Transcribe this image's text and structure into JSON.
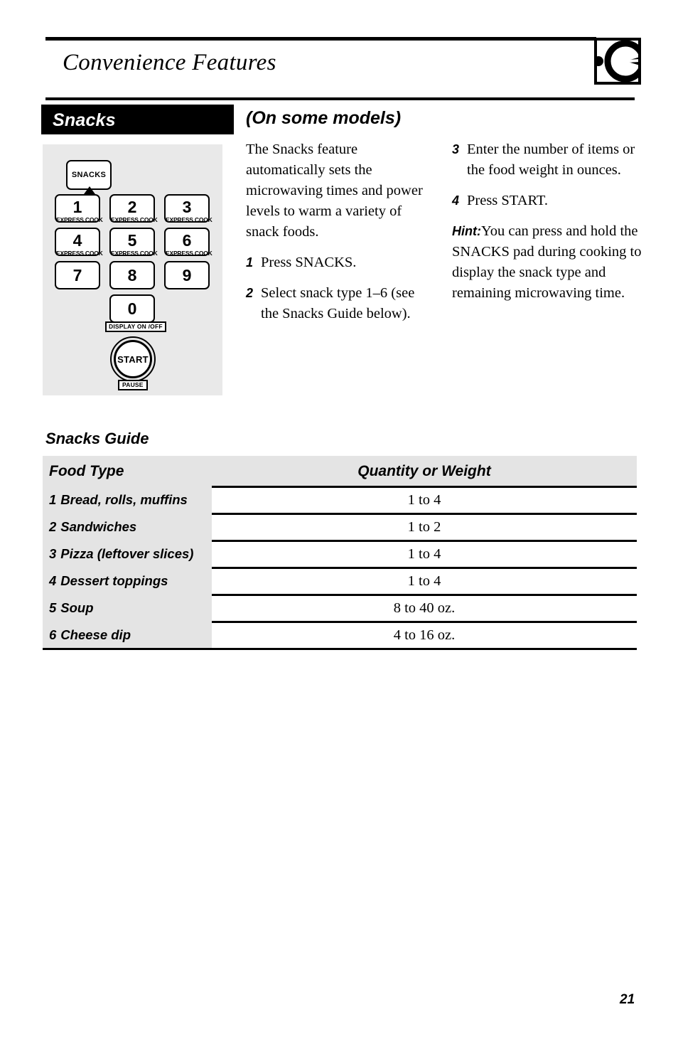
{
  "header": {
    "title": "Convenience Features",
    "logo_icon": "ge-monogram-icon"
  },
  "section": {
    "bar_label": "Snacks",
    "models_note": "(On some models)"
  },
  "keypad": {
    "snacks_key": "SNACKS",
    "keys": [
      {
        "num": "1",
        "sub": "EXPRESS COOK"
      },
      {
        "num": "2",
        "sub": "EXPRESS COOK"
      },
      {
        "num": "3",
        "sub": "EXPRESS COOK"
      },
      {
        "num": "4",
        "sub": "EXPRESS COOK"
      },
      {
        "num": "5",
        "sub": "EXPRESS COOK"
      },
      {
        "num": "6",
        "sub": "EXPRESS COOK"
      },
      {
        "num": "7",
        "sub": ""
      },
      {
        "num": "8",
        "sub": ""
      },
      {
        "num": "9",
        "sub": ""
      },
      {
        "num": "0",
        "sub": ""
      }
    ],
    "display_tag": "DISPLAY ON /OFF",
    "start_label": "START",
    "pause_tag": "PAUSE"
  },
  "body": {
    "intro": "The Snacks feature automatically sets the microwaving times and power levels to warm a variety of snack foods.",
    "steps": [
      {
        "marker": "1",
        "text": "Press SNACKS."
      },
      {
        "marker": "2",
        "text": "Select snack type 1–6 (see the Snacks Guide below)."
      },
      {
        "marker": "3",
        "text": "Enter the number of items or the food weight in ounces."
      },
      {
        "marker": "4",
        "text": "Press START."
      }
    ],
    "hint_label": "Hint:",
    "hint_text": "You can press and hold the SNACKS pad during cooking to display the snack type and remaining microwaving time."
  },
  "guide": {
    "title": "Snacks Guide",
    "columns": {
      "food_type": "Food Type",
      "quantity": "Quantity or Weight"
    },
    "rows": [
      {
        "index": "1",
        "food": "Bread, rolls, muffins",
        "qty": "1 to 4"
      },
      {
        "index": "2",
        "food": "Sandwiches",
        "qty": "1 to 2"
      },
      {
        "index": "3",
        "food": "Pizza (leftover slices)",
        "qty": "1 to 4"
      },
      {
        "index": "4",
        "food": "Dessert toppings",
        "qty": "1 to 4"
      },
      {
        "index": "5",
        "food": "Soup",
        "qty": "8 to 40 oz."
      },
      {
        "index": "6",
        "food": "Cheese dip",
        "qty": "4 to 16 oz."
      }
    ]
  },
  "footer": {
    "page_number": "21"
  }
}
